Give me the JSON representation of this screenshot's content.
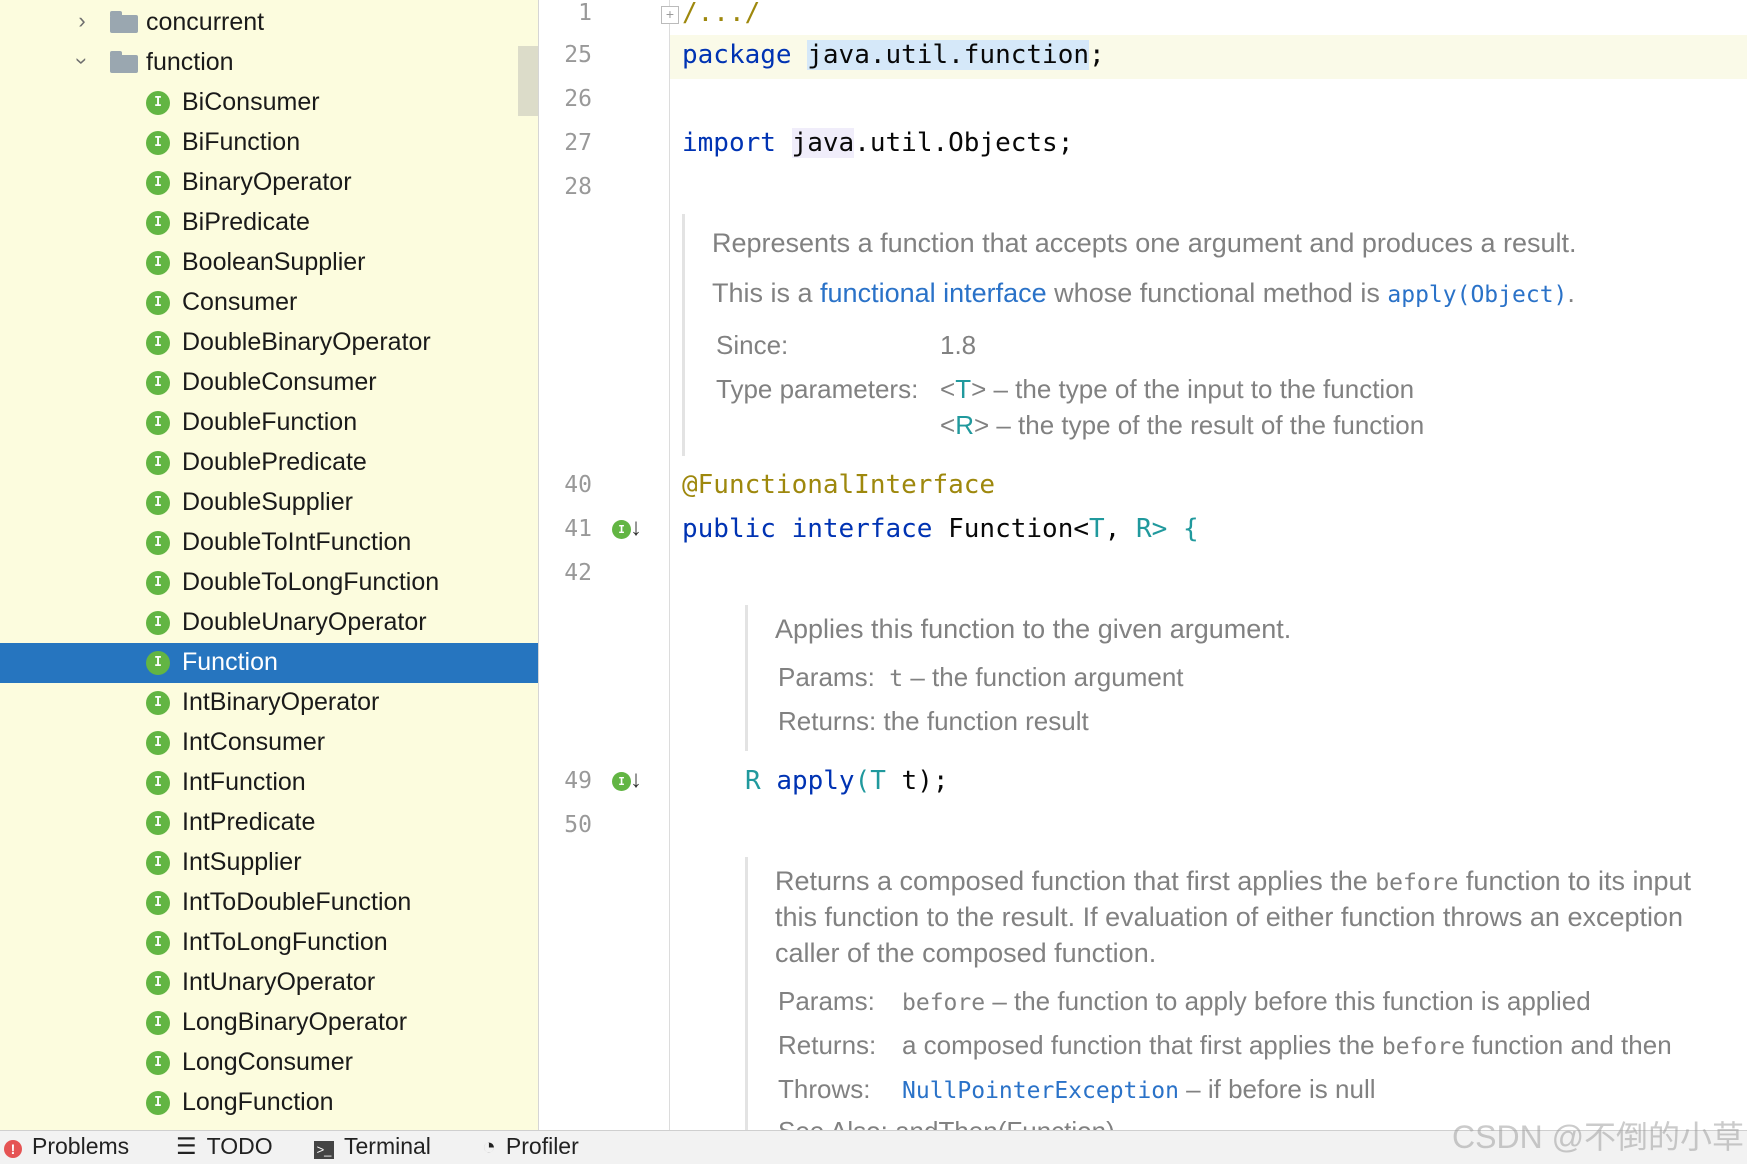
{
  "tree": {
    "folders": [
      {
        "name": "concurrent",
        "expanded": false
      },
      {
        "name": "function",
        "expanded": true
      }
    ],
    "interface_badge": "I",
    "items": [
      "BiConsumer",
      "BiFunction",
      "BinaryOperator",
      "BiPredicate",
      "BooleanSupplier",
      "Consumer",
      "DoubleBinaryOperator",
      "DoubleConsumer",
      "DoubleFunction",
      "DoublePredicate",
      "DoubleSupplier",
      "DoubleToIntFunction",
      "DoubleToLongFunction",
      "DoubleUnaryOperator",
      "Function",
      "IntBinaryOperator",
      "IntConsumer",
      "IntFunction",
      "IntPredicate",
      "IntSupplier",
      "IntToDoubleFunction",
      "IntToLongFunction",
      "IntUnaryOperator",
      "LongBinaryOperator",
      "LongConsumer",
      "LongFunction"
    ],
    "selected": "Function"
  },
  "gutter": {
    "line_numbers": [
      "1",
      "25",
      "26",
      "27",
      "28",
      "40",
      "41",
      "42",
      "49",
      "50"
    ]
  },
  "code": {
    "fold_placeholder": "/.../",
    "package_kw": "package",
    "package_name": "java.util.function",
    "semicolon": ";",
    "import_kw": "import",
    "import_pkg": "java",
    "import_rest": ".util.Objects;",
    "annotation": "@FunctionalInterface",
    "public_kw": "public",
    "interface_kw": "interface",
    "class_name": "Function",
    "lt": "<",
    "type_t": "T",
    "comma": ", ",
    "type_r": "R",
    "gt_brace": "> {",
    "method_ret": "R",
    "method_name": "apply",
    "method_lparen": "(",
    "method_param_type": "T",
    "method_param": " t",
    "method_end": ");"
  },
  "doc1": {
    "summary": "Represents a function that accepts one argument and produces a result.",
    "line2_pre": "This is a ",
    "line2_link": "functional interface",
    "line2_mid": " whose functional method is ",
    "line2_code": "apply(Object)",
    "line2_end": ".",
    "since_label": "Since:",
    "since_value": "1.8",
    "type_params_label": "Type parameters:",
    "tp1_lt": "<",
    "tp1_name": "T",
    "tp1_desc": "> – the type of the input to the function",
    "tp2_lt": "<",
    "tp2_name": "R",
    "tp2_desc": "> – the type of the result of the function"
  },
  "doc2": {
    "summary": "Applies this function to the given argument.",
    "params_label": "Params:",
    "params_code": "t",
    "params_desc": " – the function argument",
    "returns": "Returns: the function result"
  },
  "doc3": {
    "l1_pre": "Returns a composed function that first applies the ",
    "l1_code": "before",
    "l1_post": " function to its input",
    "l2": "this function to the result. If evaluation of either function throws an exception",
    "l3": "caller of the composed function.",
    "params_label": "Params:",
    "params_code": "before",
    "params_desc": " – the function to apply before this function is applied",
    "returns_label": "Returns:",
    "returns_pre": "a composed function that first applies the ",
    "returns_code": "before",
    "returns_post": " function and then",
    "throws_label": "Throws:",
    "throws_link": "NullPointerException",
    "throws_desc": " – if before is null",
    "see_partial": "See Also:  andThen(Function)"
  },
  "bottom_bar": {
    "tools": [
      {
        "icon": "problems-icon",
        "label": "Problems"
      },
      {
        "icon": "todo-icon",
        "label": "TODO"
      },
      {
        "icon": "terminal-icon",
        "label": "Terminal"
      },
      {
        "icon": "profiler-icon",
        "label": "Profiler"
      }
    ]
  },
  "watermark": "CSDN @不倒的小草",
  "colors": {
    "tree_bg": "#fcfcde",
    "selection": "#2675bf",
    "interface_icon": "#62b543",
    "keyword": "#0033b3",
    "annotation": "#9e880d",
    "type_param": "#20999d",
    "doc_link": "#2a72c8",
    "doc_text": "#818181"
  }
}
